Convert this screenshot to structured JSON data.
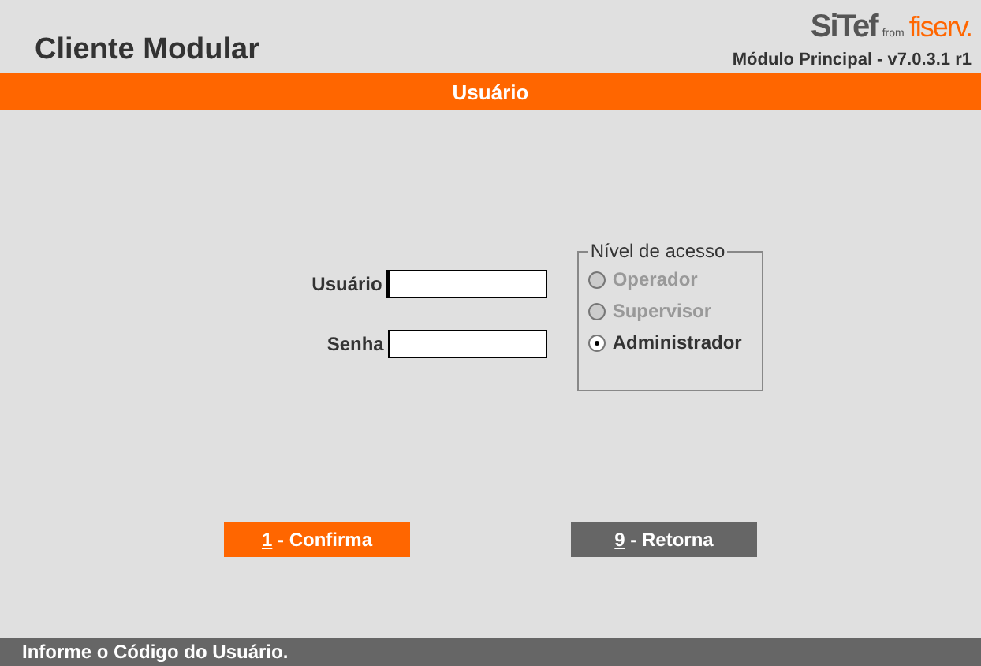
{
  "app_title": "Cliente Modular",
  "logo": {
    "brand": "SiTef",
    "joiner": "from",
    "partner": "fiserv."
  },
  "version": "Módulo Principal - v7.0.3.1 r1",
  "section_title": "Usuário",
  "fields": [
    {
      "label": "Usuário",
      "focused": true
    },
    {
      "label": "Senha",
      "focused": false
    }
  ],
  "access_level": {
    "legend": "Nível de acesso",
    "options": [
      {
        "label": "Operador",
        "selected": false,
        "disabled": true
      },
      {
        "label": "Supervisor",
        "selected": false,
        "disabled": true
      },
      {
        "label": "Administrador",
        "selected": true,
        "disabled": false
      }
    ]
  },
  "buttons": [
    {
      "key": "1",
      "label": " - Confirma",
      "kind": "primary"
    },
    {
      "key": "9",
      "label": " - Retorna",
      "kind": "secondary"
    }
  ],
  "status": "Informe o Código do Usuário."
}
